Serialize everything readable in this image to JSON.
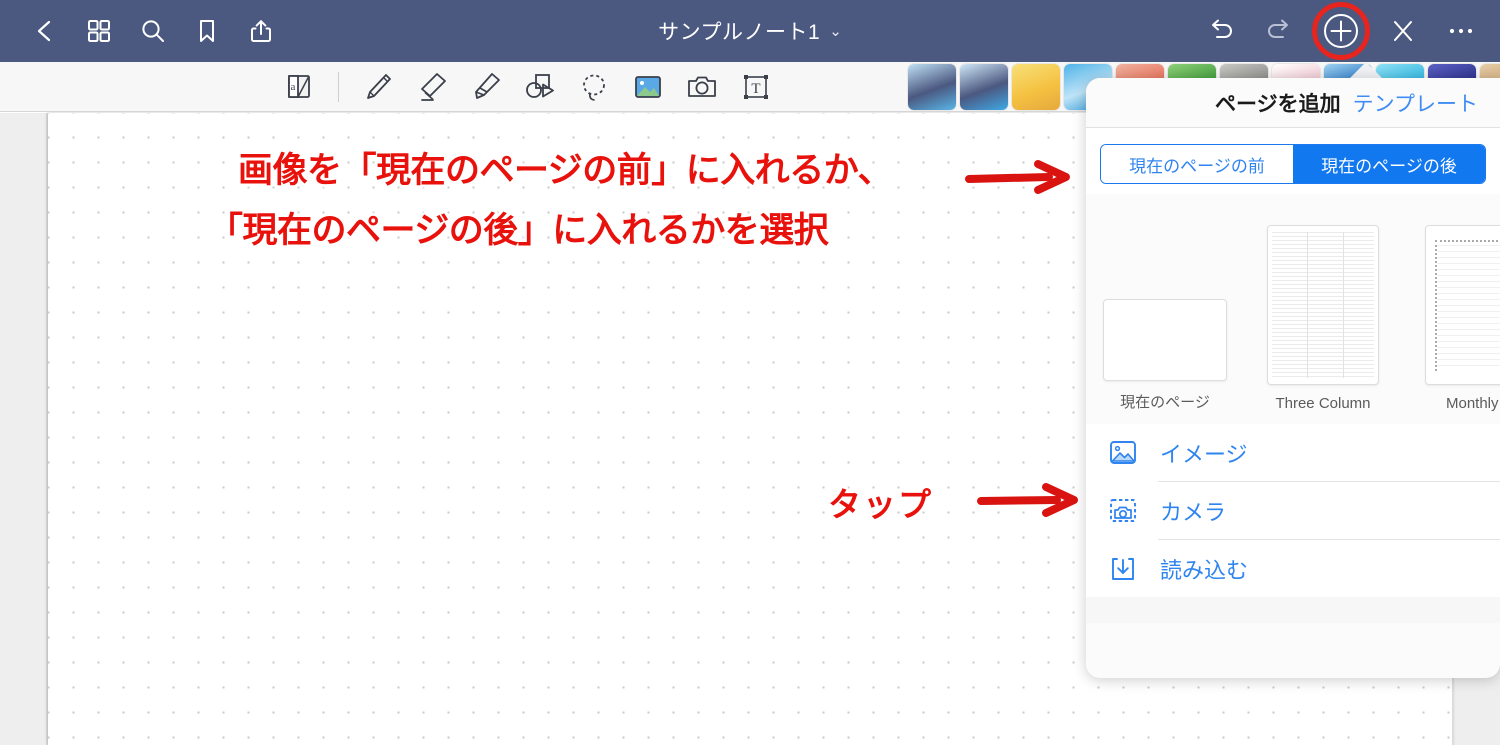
{
  "app": {
    "header_color": "#4b5880",
    "accent_blue": "#2f84f0",
    "annotation_red": "#e8110b"
  },
  "topbar": {
    "back_label": "back-chevron",
    "grid_label": "page-thumbnails",
    "search_label": "search",
    "bookmark_label": "bookmark",
    "share_label": "share",
    "title": "サンプルノート1",
    "title_chevron": "⌄",
    "undo_label": "undo",
    "redo_label": "redo",
    "add_label": "add",
    "close_label": "close",
    "more_label": "more"
  },
  "toolbar": {
    "tools": [
      {
        "name": "page-flip-tool",
        "label": "ページめくり"
      },
      {
        "name": "pen-tool",
        "label": "ペン"
      },
      {
        "name": "eraser-tool",
        "label": "消しゴム"
      },
      {
        "name": "highlighter-tool",
        "label": "蛍光ペン"
      },
      {
        "name": "shape-tool",
        "label": "図形"
      },
      {
        "name": "lasso-tool",
        "label": "なげなわ"
      },
      {
        "name": "image-tool",
        "label": "イメージ"
      },
      {
        "name": "camera-tool",
        "label": "カメラ"
      },
      {
        "name": "text-tool",
        "label": "テキスト"
      }
    ],
    "thumbnails": [
      {
        "name": "thumb-screenshot-1",
        "c1": "#4b5880",
        "c2": "#bfe0f5",
        "c3": "#58b6e8"
      },
      {
        "name": "thumb-screenshot-2",
        "c1": "#4b5880",
        "c2": "#cfe7f8",
        "c3": "#3fa9e6"
      },
      {
        "name": "thumb-sunset",
        "c1": "#f5c242",
        "c2": "#f7e07a",
        "c3": "#e5a93c"
      },
      {
        "name": "thumb-sea",
        "c1": "#bfe4f7",
        "c2": "#4fb3e8",
        "c3": "#2f9ad8"
      },
      {
        "name": "thumb-coral",
        "c1": "#e8705a",
        "c2": "#f0b3a0",
        "c3": "#d9543f"
      },
      {
        "name": "thumb-leaves",
        "c1": "#3e9b3a",
        "c2": "#8fd07a",
        "c3": "#2e7a2b"
      },
      {
        "name": "thumb-stone",
        "c1": "#8a8a88",
        "c2": "#c8c8c4",
        "c3": "#5c5c58"
      },
      {
        "name": "thumb-candy",
        "c1": "#f0c6d0",
        "c2": "#ffffff",
        "c3": "#e08a9a"
      },
      {
        "name": "thumb-blue-wave",
        "c1": "#1f6fc0",
        "c2": "#9fd2f2",
        "c3": "#0e56a0"
      },
      {
        "name": "thumb-cyan",
        "c1": "#2fb6e0",
        "c2": "#8fe0f5",
        "c3": "#1a93c4"
      },
      {
        "name": "thumb-navy",
        "c1": "#2b2f8a",
        "c2": "#5b62c4",
        "c3": "#1a1e62"
      },
      {
        "name": "thumb-wood",
        "c1": "#caa271",
        "c2": "#e6cda8",
        "c3": "#a8824f"
      }
    ]
  },
  "annotations": [
    {
      "name": "annotation-line-1",
      "text": "画像を「現在のページの前」に入れるか、"
    },
    {
      "name": "annotation-line-2",
      "text": "「現在のページの後」に入れるかを選択"
    },
    {
      "name": "annotation-tap",
      "text": "タップ"
    }
  ],
  "panel": {
    "title": "ページを追加",
    "template_link": "テンプレート",
    "segmented": {
      "before": "現在のページの前",
      "after": "現在のページの後",
      "selected": "現在のページの後"
    },
    "templates": [
      {
        "name": "template-current-page",
        "label": "現在のページ",
        "kind": "blank-landscape"
      },
      {
        "name": "template-three-column",
        "label": "Three Column",
        "kind": "three-column"
      },
      {
        "name": "template-monthly-planner",
        "label": "Monthly Pl",
        "kind": "monthly"
      }
    ],
    "menu": [
      {
        "name": "menu-item-image",
        "label": "イメージ",
        "icon": "image-icon"
      },
      {
        "name": "menu-item-camera",
        "label": "カメラ",
        "icon": "camera-icon"
      },
      {
        "name": "menu-item-import",
        "label": "読み込む",
        "icon": "import-icon"
      }
    ]
  }
}
